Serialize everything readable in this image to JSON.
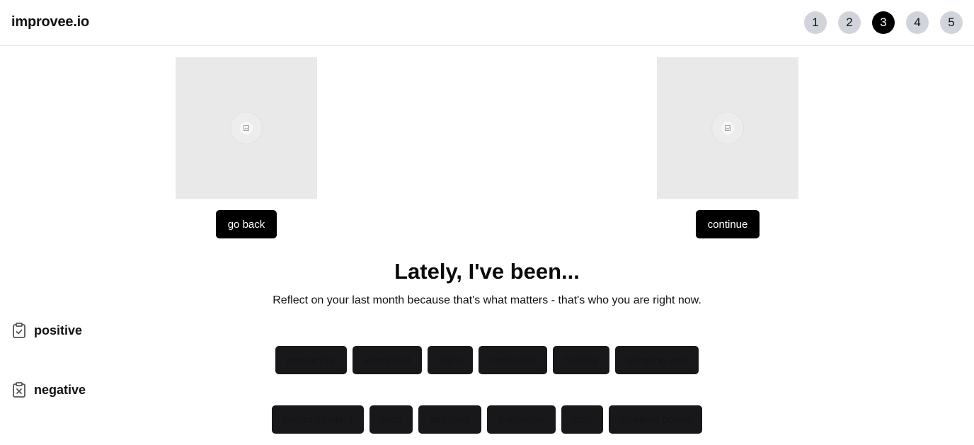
{
  "header": {
    "logo": "improvee.io",
    "steps": [
      "1",
      "2",
      "3",
      "4",
      "5"
    ],
    "active_step": "3"
  },
  "navigation": {
    "back": {
      "label": "go back",
      "image_icon": "image-placeholder-icon"
    },
    "next": {
      "label": "continue",
      "image_icon": "image-placeholder-icon"
    }
  },
  "main": {
    "heading": "Lately, I've been...",
    "subheading": "Reflect on your last month because that's what matters - that's who you are right now."
  },
  "positive": {
    "label": "positive",
    "icon": "clipboard-check-icon",
    "chips": [
      "productive",
      "energized",
      "calm",
      "motivated",
      "healthy",
      "sleeping well"
    ]
  },
  "negative": {
    "label": "negative",
    "icon": "clipboard-x-icon",
    "chips": [
      "procrastinating",
      "tired",
      "stressed",
      "unhealthy",
      "lazy",
      "sleeping poorly"
    ]
  },
  "colors": {
    "primary": "#000000",
    "step_inactive": "#d1d5db",
    "chip_bg": "#18181b",
    "placeholder_bg": "#e9e9e9"
  }
}
